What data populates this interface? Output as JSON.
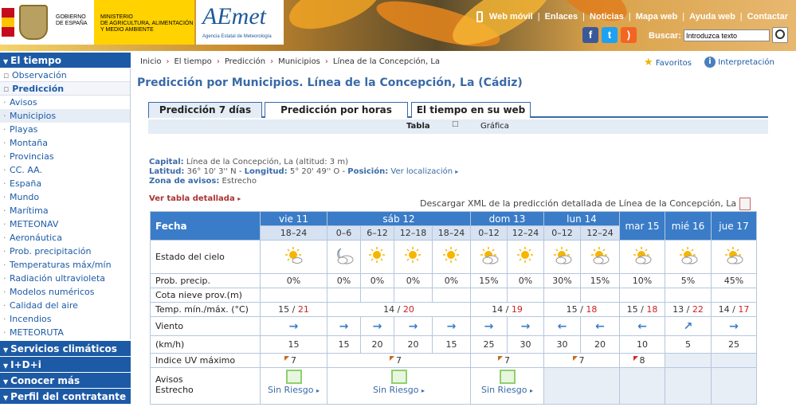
{
  "header": {
    "gov_line1": "GOBIERNO",
    "gov_line2": "DE ESPAÑA",
    "ministry_line1": "MINISTERIO",
    "ministry_line2": "DE AGRICULTURA, ALIMENTACIÓN",
    "ministry_line3": "Y MEDIO AMBIENTE",
    "aemet_logo": "AEmet",
    "aemet_sub": "Agencia Estatal de Meteorología",
    "nav": [
      "Web móvil",
      "Enlaces",
      "Noticias",
      "Mapa web",
      "Ayuda web",
      "Contactar"
    ],
    "search_label": "Buscar:",
    "search_placeholder": "Introduzca texto"
  },
  "sidebar": {
    "section_main": "El tiempo",
    "observacion": "Observación",
    "prediccion": "Predicción",
    "items": [
      "Avisos",
      "Municipios",
      "Playas",
      "Montaña",
      "Provincias",
      "CC. AA.",
      "España",
      "Mundo",
      "Marítima",
      "METEONAV",
      "Aeronáutica",
      "Prob. precipitación",
      "Temperaturas máx/mín",
      "Radiación ultravioleta",
      "Modelos numéricos",
      "Calidad del aire",
      "Incendios",
      "METEORUTA"
    ],
    "active_item": "Municipios",
    "sections": [
      "Servicios climáticos",
      "I+D+i",
      "Conocer más",
      "Perfil del contratante"
    ]
  },
  "breadcrumb": [
    "Inicio",
    "El tiempo",
    "Predicción",
    "Municipios",
    "Línea de la Concepción, La"
  ],
  "favoritos": "Favoritos",
  "interpretacion": "Interpretación",
  "page_title": "Predicción por Municipios. Línea de la Concepción, La (Cádiz)",
  "tabs": [
    "Predicción 7 días",
    "Predicción por horas",
    "El tiempo en su web"
  ],
  "subtabs": [
    "Tabla",
    "Gráfica"
  ],
  "info": {
    "capital_label": "Capital:",
    "capital_value": "Línea de la Concepción, La (altitud: 3 m)",
    "latitud_label": "Latitud:",
    "latitud_value": "36° 10' 3'' N",
    "longitud_label": "Longitud:",
    "longitud_value": "5° 20' 49'' O",
    "posicion_label": "Posición:",
    "posicion_value": "Ver localización",
    "zona_label": "Zona de avisos:",
    "zona_value": "Estrecho"
  },
  "detail_link": "Ver tabla detallada",
  "xml_text": "Descargar XML de la predicción detallada de Línea de la Concepción, La",
  "table": {
    "fecha": "Fecha",
    "days": [
      "vie 11",
      "sáb 12",
      "dom 13",
      "lun 14",
      "mar 15",
      "mié 16",
      "jue 17"
    ],
    "hours": [
      "18–24",
      "0–6",
      "6–12",
      "12–18",
      "18–24",
      "0–12",
      "12–24",
      "0–12",
      "12–24"
    ],
    "row_labels": {
      "sky": "Estado del cielo",
      "precip": "Prob. precip.",
      "snow": "Cota nieve prov.(m)",
      "temp": "Temp. mín./máx. (°C)",
      "wind": "Viento",
      "kmh": "(km/h)",
      "uv": "Indice UV máximo",
      "avisos_1": "Avisos",
      "avisos_2": "Estrecho"
    },
    "sky_icons": [
      "sun-cloud-icon",
      "moon-cloud-icon",
      "sun-icon",
      "sun-icon",
      "sun-icon",
      "cloud-sun-icon",
      "sun-icon",
      "cloud-sun-icon",
      "cloud-sun-icon",
      "cloud-sun-icon",
      "cloud-sun-icon",
      "cloud-sun-icon"
    ],
    "precip": [
      "0%",
      "0%",
      "0%",
      "0%",
      "0%",
      "15%",
      "0%",
      "30%",
      "15%",
      "10%",
      "5%",
      "45%"
    ],
    "temp_min": [
      "15",
      "14",
      "14",
      "15",
      "15",
      "13",
      "14"
    ],
    "temp_max": [
      "21",
      "20",
      "19",
      "18",
      "18",
      "22",
      "17"
    ],
    "temp_sep": "/",
    "wind_arrows": [
      "→",
      "→",
      "→",
      "→",
      "→",
      "→",
      "→",
      "←",
      "←",
      "←",
      "↗",
      "→"
    ],
    "wind_speed": [
      "15",
      "15",
      "20",
      "20",
      "15",
      "25",
      "30",
      "30",
      "20",
      "10",
      "5",
      "25"
    ],
    "uv": [
      "7",
      "7",
      "7",
      "7",
      "8"
    ],
    "avisos_label": "Sin Riesgo",
    "avisos_arrow": "▸"
  },
  "colors": {
    "primary": "#3a7cc8",
    "title": "#3a6aa8",
    "temp_max": "#cc2222",
    "uv_orange": "#c76a1a",
    "uv_red": "#d8262a"
  }
}
